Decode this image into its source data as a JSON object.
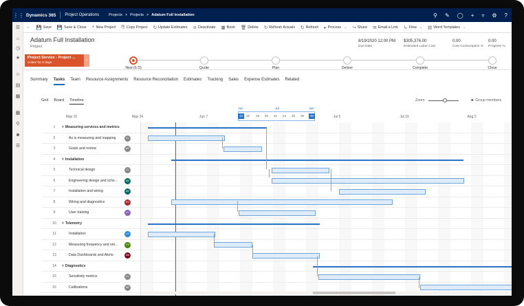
{
  "topnav": {
    "brand": "Dynamics 365",
    "app": "Project Operations",
    "crumbs": [
      "Projects",
      "Projects",
      "Adatum Full Installation"
    ]
  },
  "commands": [
    {
      "icon": "←",
      "label": ""
    },
    {
      "icon": "💾",
      "label": "Save"
    },
    {
      "icon": "💾",
      "label": "Save & Close"
    },
    {
      "icon": "+",
      "label": "New Project"
    },
    {
      "icon": "⎘",
      "label": "Copy Project"
    },
    {
      "icon": "↻",
      "label": "Update Estimates"
    },
    {
      "icon": "⊘",
      "label": "Deactivate"
    },
    {
      "icon": "▦",
      "label": "Book"
    },
    {
      "icon": "🗑",
      "label": "Delete"
    },
    {
      "icon": "↻",
      "label": "Refresh Actuals"
    },
    {
      "icon": "↻",
      "label": "Refresh"
    },
    {
      "icon": "▸",
      "label": "Process"
    },
    {
      "icon": "↪",
      "label": "Share"
    },
    {
      "icon": "✉",
      "label": "Email a Link"
    },
    {
      "icon": "↳",
      "label": "Flow"
    },
    {
      "icon": "▤",
      "label": "Word Templates"
    }
  ],
  "record": {
    "title": "Adatum Full Installation",
    "type": "Project",
    "fields": [
      {
        "value": "8/19/2020 12:00 PM",
        "label": "Due Date"
      },
      {
        "value": "$305,376.00",
        "label": "Estimated Labor Cost"
      },
      {
        "value": "0.00",
        "label": "Cost Consumption %"
      },
      {
        "value": "0.00",
        "label": "Progress %"
      }
    ]
  },
  "bpf": {
    "active_title": "Project Service - Project ...",
    "active_sub": "Active for 6 days",
    "stages": [
      "New  (6 D)",
      "Quote",
      "Plan",
      "Deliver",
      "Complete",
      "Close"
    ]
  },
  "tabs": [
    "Summary",
    "Tasks",
    "Team",
    "Resource Assignments",
    "Resource Reconciliation",
    "Estimates",
    "Tracking",
    "Sales",
    "Expense Estimates",
    "Related"
  ],
  "active_tab": 1,
  "subtabs": [
    "Grid",
    "Board",
    "Timeline"
  ],
  "active_subtab": 2,
  "zoom_label": "Zoom",
  "group_members_label": "Group members",
  "timeline": {
    "dates": [
      "May 10",
      "May 24",
      "Jun 7",
      "Jul 5",
      "Jul 19",
      "Aug 2"
    ],
    "months": [
      "Jun",
      "Jul",
      "Jun"
    ],
    "days": [
      "15",
      "16",
      "18",
      "20",
      "22",
      "24",
      "26",
      "28",
      "25",
      "30"
    ]
  },
  "rows": [
    {
      "num": "1",
      "name": "Measuring services and metrics",
      "summary": true
    },
    {
      "num": "2",
      "name": "As is measuring and mapping",
      "avatar": "CL",
      "color": "#8a8886"
    },
    {
      "num": "3",
      "name": "Goals and review",
      "avatar": "MF",
      "color": "#8a8886"
    },
    {
      "num": "4",
      "name": "Installation",
      "summary": true
    },
    {
      "num": "5",
      "name": "Technical design",
      "avatar": "CL",
      "color": "#8a8886"
    },
    {
      "num": "6",
      "name": "Engineering design and sche...",
      "avatar": "AK",
      "color": "#0b6a62"
    },
    {
      "num": "7",
      "name": "Installation and wiring",
      "avatar": "AK",
      "color": "#0b6a62"
    },
    {
      "num": "8",
      "name": "Wiring and diagnostics",
      "avatar": "RG",
      "color": "#a4262c"
    },
    {
      "num": "9",
      "name": "User training",
      "avatar": "LC",
      "color": "#8764b8"
    },
    {
      "num": "10",
      "name": "Telemetry",
      "summary": true
    },
    {
      "num": "11",
      "name": "Installation",
      "avatar": "LN",
      "color": "#2b88d8"
    },
    {
      "num": "12",
      "name": "Measuring frequency and set...",
      "avatar": "CN",
      "color": "#498205"
    },
    {
      "num": "13",
      "name": "Data Dashboards and Alerts",
      "avatar": "MA",
      "color": "#750b1c"
    },
    {
      "num": "14",
      "name": "Diagnostics",
      "summary": true
    },
    {
      "num": "15",
      "name": "Sensitivity metrics",
      "avatar": "CL",
      "color": "#8a8886"
    },
    {
      "num": "16",
      "name": "Calibrations",
      "avatar": "MF",
      "color": "#8a8886"
    }
  ]
}
